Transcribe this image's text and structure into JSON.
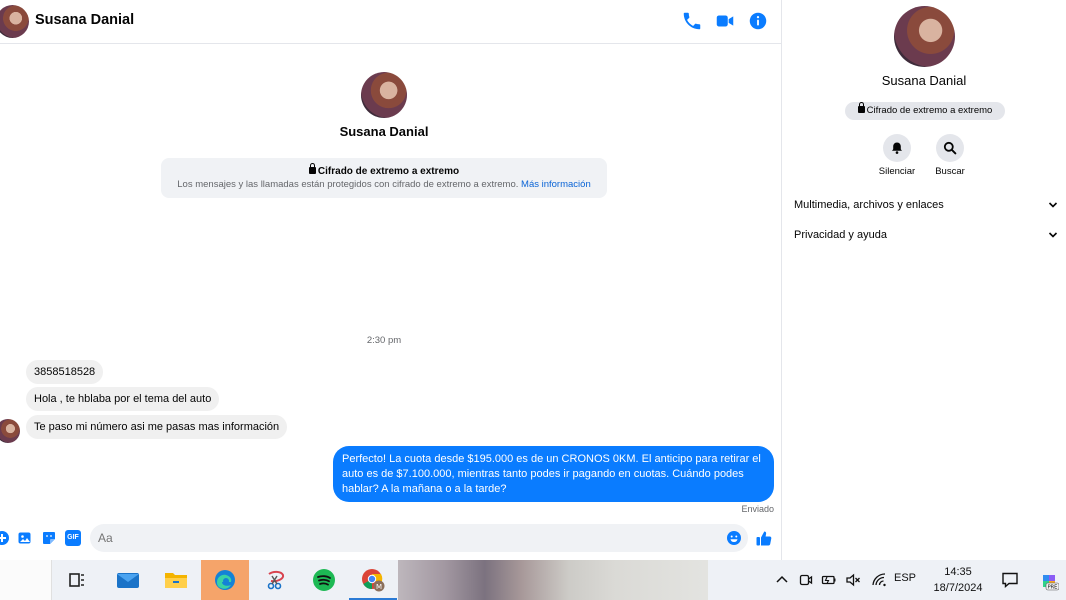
{
  "contact": {
    "name": "Susana Danial"
  },
  "header": {
    "icons": {
      "call": "phone-icon",
      "video": "video-camera-icon",
      "info": "info-icon"
    }
  },
  "encryption": {
    "title": "Cifrado de extremo a extremo",
    "text": "Los mensajes y las llamadas están protegidos con cifrado de extremo a extremo.",
    "link": "Más información"
  },
  "conversation": {
    "timestamp": "2:30 pm",
    "incoming": [
      "3858518528",
      "Hola , te hblaba por el tema del auto",
      "Te paso mi número asi me pasas mas información"
    ],
    "outgoing": "Perfecto! La cuota desde $195.000 es de un CRONOS 0KM. El anticipo para retirar el auto es de $7.100.000, mientras tanto podes ir pagando en cuotas. Cuándo podes hablar? A la mañana o a la tarde?",
    "status": "Enviado"
  },
  "composer": {
    "placeholder": "Aa",
    "gif_label": "GIF"
  },
  "side_panel": {
    "name": "Susana Danial",
    "badge": "Cifrado de extremo a extremo",
    "actions": {
      "mute": "Silenciar",
      "search": "Buscar"
    },
    "rows": {
      "media": "Multimedia, archivos y enlaces",
      "privacy": "Privacidad y ayuda"
    }
  },
  "taskbar": {
    "language": "ESP",
    "time": "14:35",
    "date": "18/7/2024"
  },
  "colors": {
    "accent": "#0a7cff",
    "link": "#0a64d6",
    "incoming_bubble": "#f0f0f0"
  }
}
